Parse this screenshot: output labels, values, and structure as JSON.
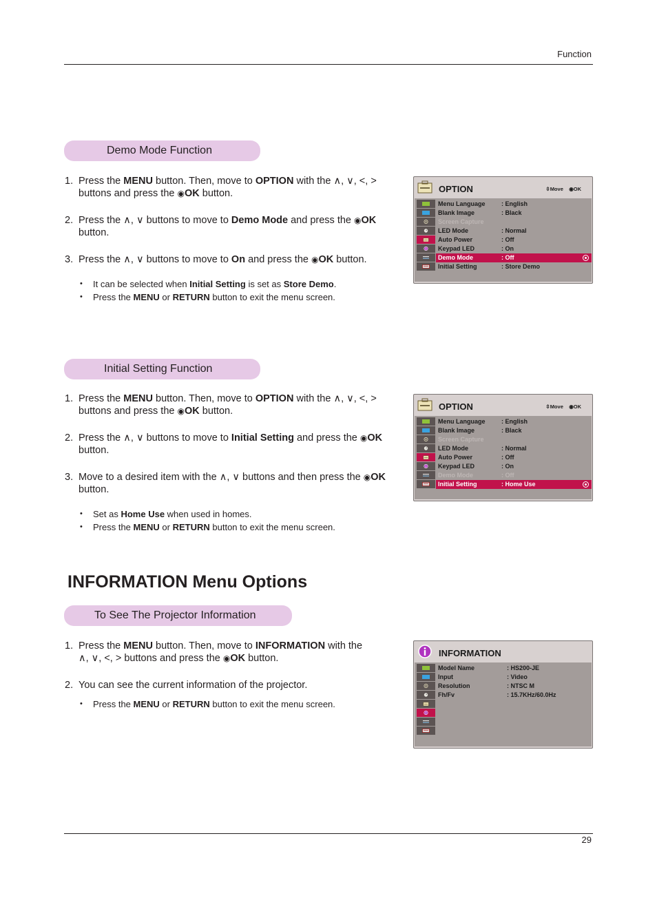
{
  "header": {
    "section": "Function",
    "page_number": "29"
  },
  "demo_mode": {
    "pill": "Demo Mode Function",
    "steps": [
      {
        "num": "1.",
        "parts": [
          "Press the ",
          "MENU",
          " button. Then, move to ",
          "OPTION",
          " with the ∧, ∨, <, >",
          " buttons and press the ",
          "◉",
          "OK",
          " button."
        ]
      },
      {
        "num": "2.",
        "parts": [
          "Press the ∧, ∨ buttons to move to ",
          "Demo Mode",
          " and press the ",
          "◉",
          "OK",
          " button."
        ]
      },
      {
        "num": "3.",
        "parts": [
          "Press the ∧, ∨ buttons to move to ",
          "On",
          " and press the ",
          "◉",
          "OK",
          " button."
        ]
      }
    ],
    "bullets": [
      {
        "parts": [
          "It can be selected when ",
          "Initial Setting",
          " is set as ",
          "Store Demo",
          "."
        ]
      },
      {
        "parts": [
          "Press the ",
          "MENU",
          " or ",
          "RETURN",
          " button to exit the menu screen."
        ]
      }
    ],
    "osd": {
      "title": "OPTION",
      "hint_move": "Move",
      "hint_ok": "OK",
      "rows": [
        {
          "label": "Menu Language",
          "value": ": English",
          "state": "normal"
        },
        {
          "label": "Blank Image",
          "value": ": Black",
          "state": "normal"
        },
        {
          "label": "Screen Capture",
          "value": "",
          "state": "disabled"
        },
        {
          "label": "LED Mode",
          "value": ": Normal",
          "state": "normal"
        },
        {
          "label": "Auto Power",
          "value": ": Off",
          "state": "normal"
        },
        {
          "label": "Keypad LED",
          "value": ": On",
          "state": "normal"
        },
        {
          "label": "Demo Mode",
          "value": ": Off",
          "state": "selected"
        },
        {
          "label": "Initial Setting",
          "value": ": Store Demo",
          "state": "normal"
        }
      ]
    }
  },
  "initial_setting": {
    "pill": "Initial Setting Function",
    "steps": [
      {
        "num": "1.",
        "parts": [
          "Press the ",
          "MENU",
          " button. Then, move to ",
          "OPTION",
          " with the ∧, ∨, <, >",
          " buttons and press the ",
          "◉",
          "OK",
          " button."
        ]
      },
      {
        "num": "2.",
        "parts": [
          "Press the ∧, ∨ buttons to move to ",
          "Initial Setting",
          " and press the ",
          "◉",
          "OK",
          " button."
        ]
      },
      {
        "num": "3.",
        "parts": [
          "Move to a desired item with the ∧, ∨  buttons and then press the ",
          "◉",
          "OK",
          " button."
        ]
      }
    ],
    "bullets": [
      {
        "parts": [
          "Set as ",
          "Home Use",
          " when used in homes."
        ]
      },
      {
        "parts": [
          "Press the ",
          "MENU",
          " or ",
          "RETURN",
          " button to exit the menu screen."
        ]
      }
    ],
    "osd": {
      "title": "OPTION",
      "hint_move": "Move",
      "hint_ok": "OK",
      "rows": [
        {
          "label": "Menu Language",
          "value": ": English",
          "state": "normal"
        },
        {
          "label": "Blank Image",
          "value": ": Black",
          "state": "normal"
        },
        {
          "label": "Screen Capture",
          "value": "",
          "state": "disabled"
        },
        {
          "label": "LED Mode",
          "value": ": Normal",
          "state": "normal"
        },
        {
          "label": "Auto Power",
          "value": ": Off",
          "state": "normal"
        },
        {
          "label": "Keypad LED",
          "value": ": On",
          "state": "normal"
        },
        {
          "label": "Demo Mode",
          "value": ": Off",
          "state": "disabled"
        },
        {
          "label": "Initial Setting",
          "value": ": Home Use",
          "state": "selected"
        }
      ]
    }
  },
  "information": {
    "title": "INFORMATION Menu Options",
    "pill": "To See The Projector Information",
    "steps": [
      {
        "num": "1.",
        "parts": [
          "Press the ",
          "MENU",
          " button. Then, move to ",
          "INFORMATION",
          " with the ∧, ∨, <, >",
          " buttons and press the ",
          "◉",
          "OK",
          " button."
        ]
      },
      {
        "num": "2.",
        "parts": [
          "You can see the current information of the projector."
        ]
      }
    ],
    "bullets": [
      {
        "parts": [
          "Press the ",
          "MENU",
          " or ",
          "RETURN",
          " button to exit the menu screen."
        ]
      }
    ],
    "osd": {
      "title": "INFORMATION",
      "rows": [
        {
          "label": "Model Name",
          "value": ": HS200-JE"
        },
        {
          "label": "Input",
          "value": ": Video"
        },
        {
          "label": "Resolution",
          "value": ": NTSC M"
        },
        {
          "label": "Fh/Fv",
          "value": ": 15.7KHz/60.0Hz"
        }
      ]
    }
  },
  "sidebar_icons": [
    "picture-icon",
    "screen-icon",
    "audio-icon",
    "timer-icon",
    "option-icon",
    "information-icon",
    "input-icon",
    "keyboard-icon"
  ],
  "colors": {
    "pill": "#e6c9e6",
    "highlight": "#c1124b",
    "osd_bg": "#a39c9a",
    "osd_frame": "#d8d1d0"
  }
}
